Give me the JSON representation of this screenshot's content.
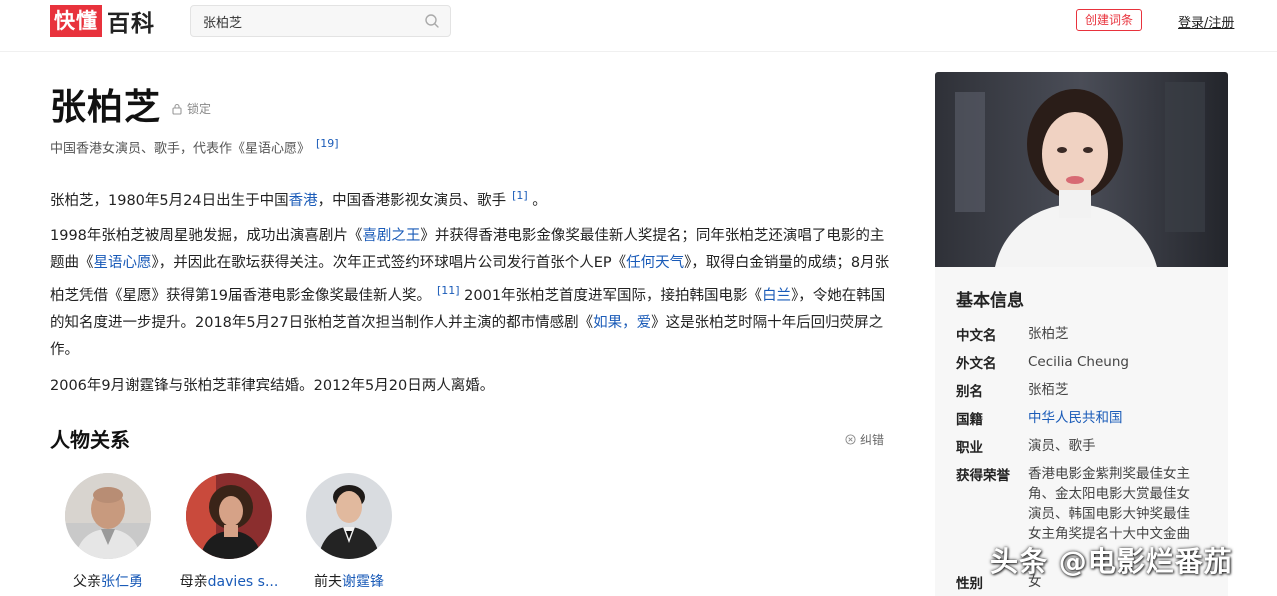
{
  "header": {
    "logo_red": "快懂",
    "logo_black": "百科",
    "search_value": "张柏芝",
    "create_label": "创建词条",
    "login_label": "登录/注册"
  },
  "article": {
    "title": "张柏芝",
    "lock_label": "锁定",
    "subtitle": "中国香港女演员、歌手，代表作《星语心愿》",
    "subtitle_ref": "[19]",
    "p1": {
      "a": "张柏芝，1980年5月24日出生于中国",
      "link_hk": "香港",
      "b": "，中国香港影视女演员、歌手",
      "ref": "[1]",
      "c": " 。"
    },
    "p2": {
      "a": "1998年张柏芝被周星驰发掘，成功出演喜剧片《",
      "link1": "喜剧之王",
      "b": "》并获得香港电影金像奖最佳新人奖提名；同年张柏芝还演唱了电影的主题曲《",
      "link2": "星语心愿",
      "c": "》，并因此在歌坛获得关注。次年正式签约环球唱片公司发行首张个人EP《",
      "link3": "任何天气",
      "d": "》，取得白金销量的成绩；8月张柏芝凭借《星愿》获得第19届香港电影金像奖最佳新人奖。",
      "ref": "[11]",
      "e": " 2001年张柏芝首度进军国际，接拍韩国电影《",
      "link4": "白兰",
      "f": "》，令她在韩国的知名度进一步提升。2018年5月27日张柏芝首次担当制作人并主演的都市情感剧《",
      "link5": "如果，爱",
      "g": "》这是张柏芝时隔十年后回归荧屏之作。"
    },
    "p3": "2006年9月谢霆锋与张柏芝菲律宾结婚。2012年5月20日两人离婚。",
    "relations_title": "人物关系",
    "correct_label": "纠错",
    "relations": [
      {
        "role": "父亲",
        "name": "张仁勇"
      },
      {
        "role": "母亲",
        "name": "davies s..."
      },
      {
        "role": "前夫",
        "name": "谢霆锋"
      }
    ]
  },
  "info": {
    "title": "基本信息",
    "rows": [
      {
        "key": "中文名",
        "value": "张柏芝"
      },
      {
        "key": "外文名",
        "value": "Cecilia Cheung"
      },
      {
        "key": "别名",
        "value": "张栢芝"
      },
      {
        "key": "国籍",
        "value": "中华人民共和国"
      },
      {
        "key": "职业",
        "value": "演员、歌手"
      },
      {
        "key": "获得荣誉",
        "value": "香港电影金紫荆奖最佳女主角、金太阳电影大赏最佳女演员、韩国电影大钟奖最佳女主角奖提名十大中文金曲"
      },
      {
        "key": "性别",
        "value": "女"
      }
    ]
  },
  "watermark": "头条 @电影烂番茄",
  "colors": {
    "brand_red": "#e8323c",
    "link_blue": "#1a5bb8"
  }
}
